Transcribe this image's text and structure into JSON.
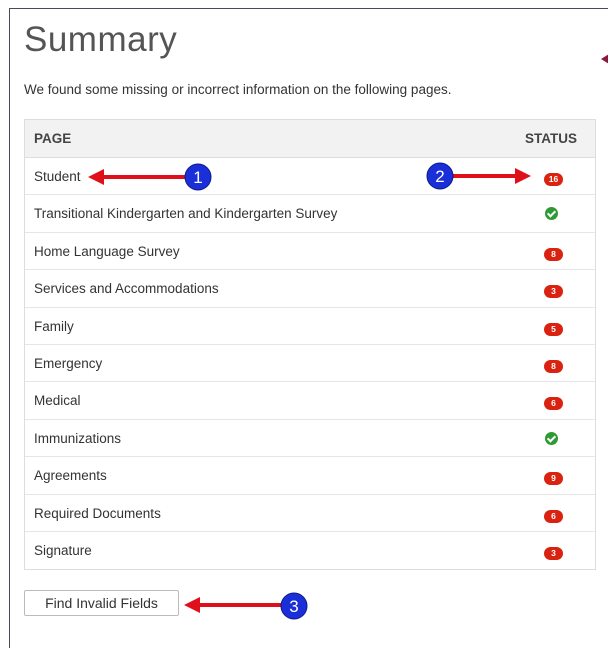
{
  "summary": {
    "title": "Summary",
    "intro": "We found some missing or incorrect information on the following pages."
  },
  "table": {
    "col_page": "PAGE",
    "col_status": "STATUS",
    "rows": [
      {
        "label": "Student",
        "status": "error",
        "count": "16"
      },
      {
        "label": "Transitional Kindergarten and Kindergarten Survey",
        "status": "ok",
        "count": ""
      },
      {
        "label": "Home Language Survey",
        "status": "error",
        "count": "8"
      },
      {
        "label": "Services and Accommodations",
        "status": "error",
        "count": "3"
      },
      {
        "label": "Family",
        "status": "error",
        "count": "5"
      },
      {
        "label": "Emergency",
        "status": "error",
        "count": "8"
      },
      {
        "label": "Medical",
        "status": "error",
        "count": "6"
      },
      {
        "label": "Immunizations",
        "status": "ok",
        "count": ""
      },
      {
        "label": "Agreements",
        "status": "error",
        "count": "9"
      },
      {
        "label": "Required Documents",
        "status": "error",
        "count": "6"
      },
      {
        "label": "Signature",
        "status": "error",
        "count": "3"
      }
    ]
  },
  "find_button": "Find Invalid Fields",
  "callouts": [
    {
      "number": "1"
    },
    {
      "number": "2"
    },
    {
      "number": "3"
    }
  ],
  "colors": {
    "error_badge": "#d9220f",
    "ok_check": "#2d9a33",
    "callout_arrow": "#e0101a",
    "callout_circle": "#1a2fd8"
  }
}
